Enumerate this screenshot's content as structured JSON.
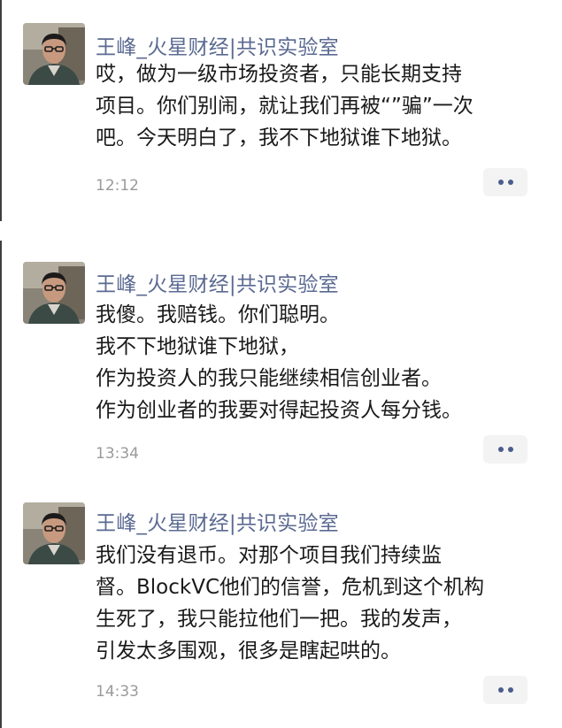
{
  "posts": [
    {
      "author": "王峰_火星财经|共识实验室",
      "lines": [
        "哎，做为一级市场投资者，只能长期支持",
        "项目。你们别闹，就让我们再被“”骗”一次",
        "吧。今天明白了，我不下地狱谁下地狱。"
      ],
      "time": "12:12",
      "avatar_icon": "user-portrait-icon",
      "more_icon": "more-dots-icon"
    },
    {
      "author": "王峰_火星财经|共识实验室",
      "lines": [
        "我傻。我赔钱。你们聪明。",
        "我不下地狱谁下地狱，",
        "作为投资人的我只能继续相信创业者。",
        "作为创业者的我要对得起投资人每分钱。"
      ],
      "time": "13:34",
      "avatar_icon": "user-portrait-icon",
      "more_icon": "more-dots-icon"
    },
    {
      "author": "王峰_火星财经|共识实验室",
      "lines": [
        "我们没有退币。对那个项目我们持续监",
        "督。BlockVC他们的信誉，危机到这个机构",
        "生死了，我只能拉他们一把。我的发声，",
        "引发太多围观，很多是瞎起哄的。"
      ],
      "time": "14:33",
      "avatar_icon": "user-portrait-icon",
      "more_icon": "more-dots-icon"
    }
  ],
  "colors": {
    "author": "#5b6a92",
    "text": "#1a1a1a",
    "time": "#9a9a9a",
    "more_bg": "#f3f3f3",
    "more_dot": "#4b5d8c"
  }
}
